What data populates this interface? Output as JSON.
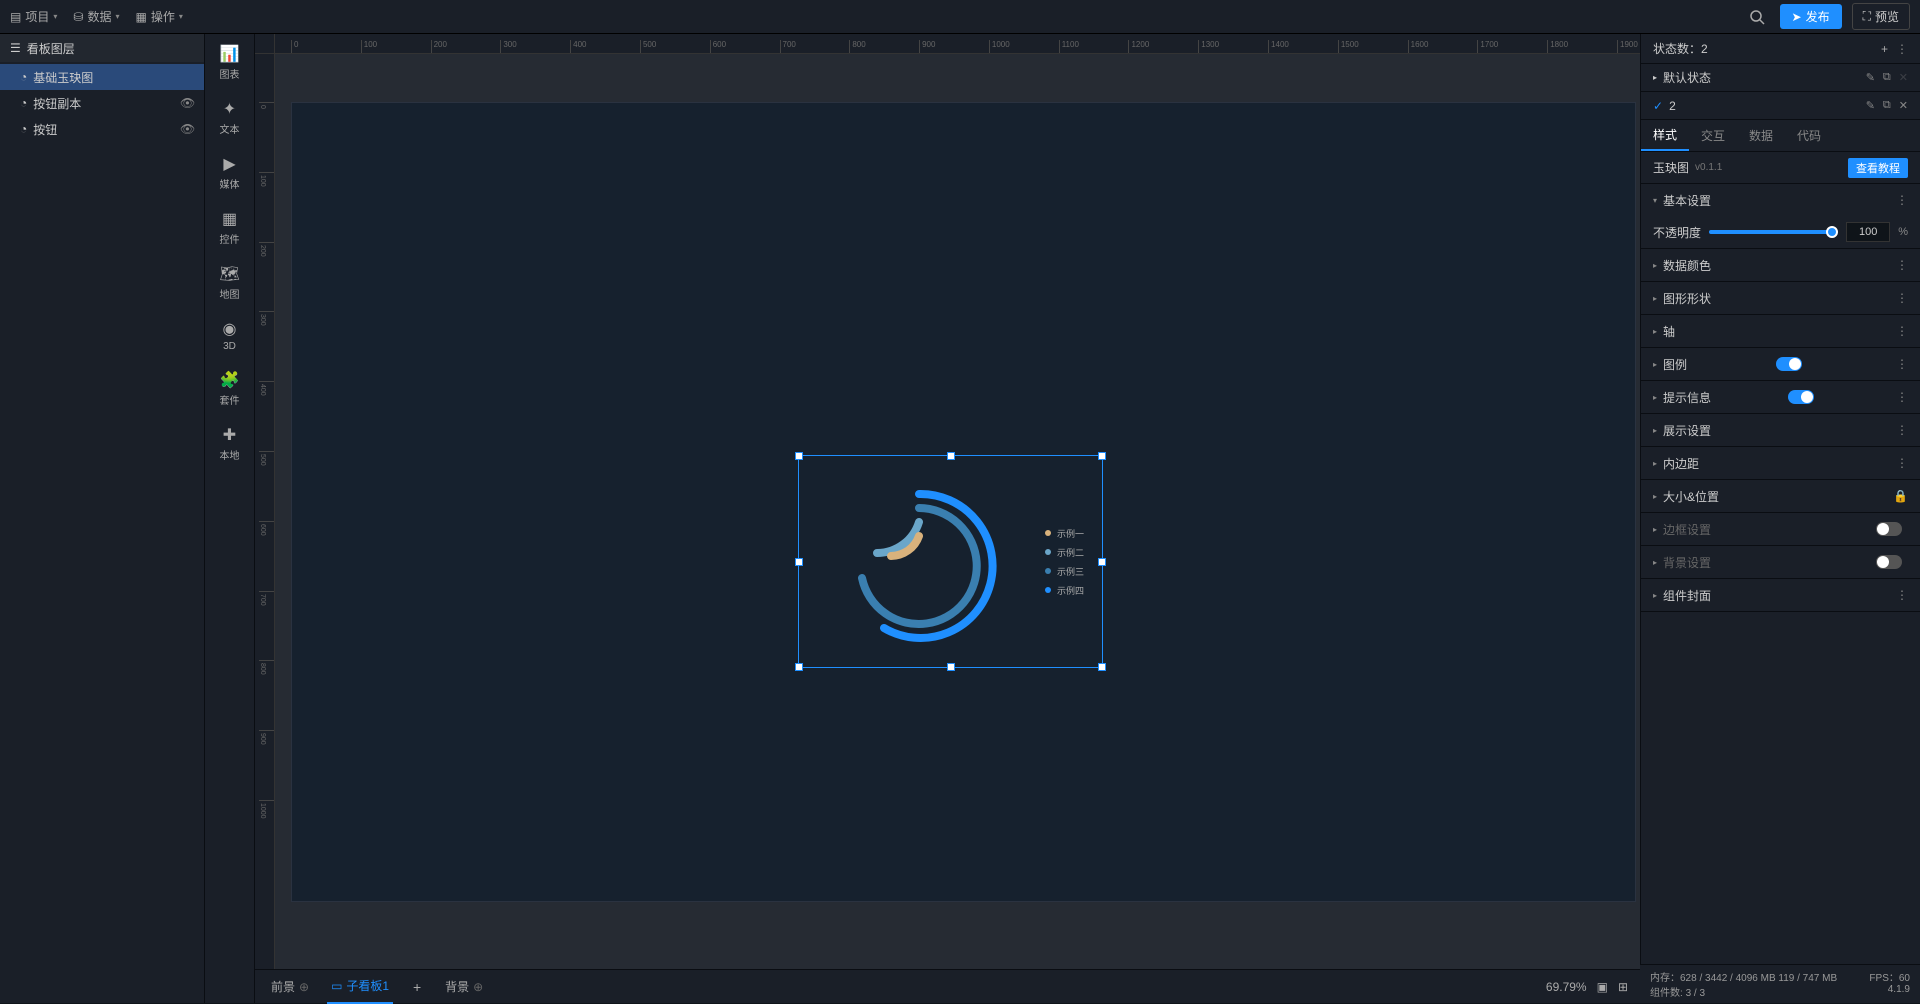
{
  "menu": {
    "project": "项目",
    "data": "数据",
    "operate": "操作"
  },
  "header_actions": {
    "publish": "发布",
    "preview": "预览"
  },
  "layer_panel": {
    "title": "看板图层",
    "items": [
      {
        "label": "基础玉玦图",
        "selected": true
      },
      {
        "label": "按钮副本",
        "selected": false,
        "eye": true
      },
      {
        "label": "按钮",
        "selected": false,
        "eye": true
      }
    ]
  },
  "comp_bar": [
    {
      "label": "图表"
    },
    {
      "label": "文本"
    },
    {
      "label": "媒体"
    },
    {
      "label": "控件"
    },
    {
      "label": "地图"
    },
    {
      "label": "3D"
    },
    {
      "label": "套件"
    },
    {
      "label": "本地"
    }
  ],
  "ruler_h": [
    0,
    100,
    200,
    300,
    400,
    500,
    600,
    700,
    800,
    900,
    1000,
    1100,
    1200,
    1300,
    1400,
    1500,
    1600,
    1700,
    1800,
    1900
  ],
  "ruler_v": [
    0,
    100,
    200,
    300,
    400,
    500,
    600,
    700,
    800,
    900,
    1000
  ],
  "chart_data": {
    "type": "polar-bar",
    "title": "玉玦图",
    "series": [
      {
        "name": "示例一",
        "value": 40,
        "color": "#d9b27c"
      },
      {
        "name": "示例二",
        "value": 55,
        "color": "#6aa6c9"
      },
      {
        "name": "示例三",
        "value": 70,
        "color": "#3a7fb0"
      },
      {
        "name": "示例四",
        "value": 85,
        "color": "#1f8fff"
      }
    ],
    "start_angle": 90,
    "clockwise": true,
    "legend_position": "right"
  },
  "bottom_bar": {
    "foreground": "前景",
    "active_tab": "子看板1",
    "background": "背景",
    "zoom": "69.79%"
  },
  "states": {
    "count_label": "状态数：",
    "count": "2",
    "default": "默认状态",
    "custom": "2"
  },
  "prop_tabs": [
    "样式",
    "交互",
    "数据",
    "代码"
  ],
  "component": {
    "name": "玉玦图",
    "version": "v0.1.1",
    "tutorial": "查看教程"
  },
  "sections": {
    "basic": "基本设置",
    "opacity_label": "不透明度",
    "opacity_value": "100",
    "opacity_unit": "%",
    "data_color": "数据颜色",
    "shape": "图形形状",
    "axis": "轴",
    "legend": "图例",
    "tooltip": "提示信息",
    "display": "展示设置",
    "padding": "内边距",
    "size_pos": "大小&位置",
    "border": "边框设置",
    "background": "背景设置",
    "cover": "组件封面"
  },
  "status": {
    "memory_label": "内存：",
    "memory": "628 / 3442 / 4096 MB  119 / 747 MB",
    "fps_label": "FPS：",
    "fps": "60",
    "comp_count_label": "组件数:",
    "comp_count": "3 / 3",
    "version": "4.1.9"
  }
}
